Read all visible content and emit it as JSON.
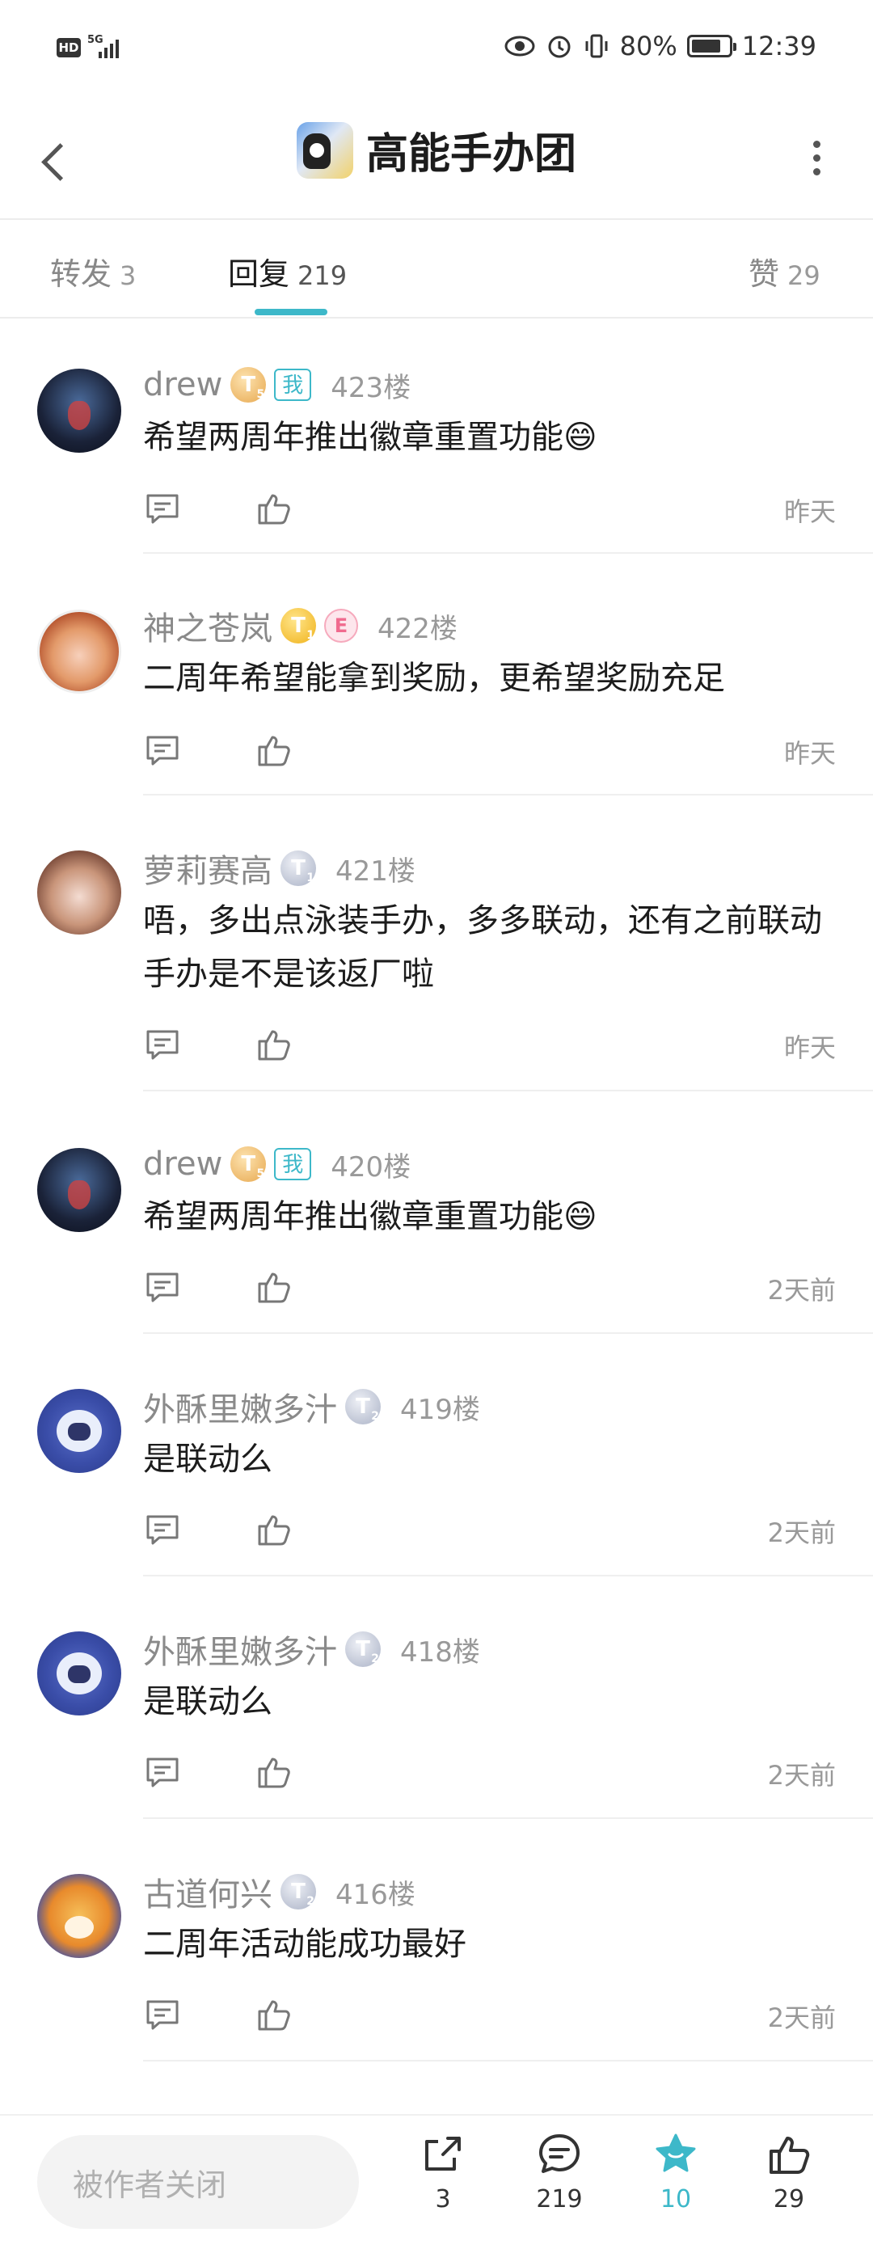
{
  "status_bar": {
    "network": "5G",
    "battery": "80%",
    "battery_level": 0.8,
    "time": "12:39"
  },
  "header": {
    "title": "高能手办团"
  },
  "tabs": [
    {
      "label": "转发",
      "count": "3"
    },
    {
      "label": "回复",
      "count": "219",
      "active": true
    },
    {
      "label": "赞",
      "count": "29"
    }
  ],
  "comments": [
    {
      "user": "drew",
      "level": "T",
      "is_me": true,
      "me_label": "我",
      "floor": "423楼",
      "text": "希望两周年推出徽章重置功能😄",
      "time": "昨天"
    },
    {
      "user": "神之苍岚",
      "level": "T",
      "extra_badge": "E",
      "floor": "422楼",
      "text": "二周年希望能拿到奖励，更希望奖励充足",
      "time": "昨天"
    },
    {
      "user": "萝莉赛高",
      "level": "T",
      "floor": "421楼",
      "text": "唔，多出点泳装手办，多多联动，还有之前联动手办是不是该返厂啦",
      "time": "昨天"
    },
    {
      "user": "drew",
      "level": "T",
      "is_me": true,
      "me_label": "我",
      "floor": "420楼",
      "text": "希望两周年推出徽章重置功能😄",
      "time": "2天前"
    },
    {
      "user": "外酥里嫩多汁",
      "level": "T",
      "floor": "419楼",
      "text": "是联动么",
      "time": "2天前"
    },
    {
      "user": "外酥里嫩多汁",
      "level": "T",
      "floor": "418楼",
      "text": "是联动么",
      "time": "2天前"
    },
    {
      "user": "古道何兴",
      "level": "T",
      "floor": "416楼",
      "text": "二周年活动能成功最好",
      "time": "2天前"
    }
  ],
  "bottom_bar": {
    "input_placeholder": "被作者关闭",
    "share_count": "3",
    "comment_count": "219",
    "favorite_count": "10",
    "like_count": "29"
  },
  "colors": {
    "accent": "#3db8c9"
  }
}
